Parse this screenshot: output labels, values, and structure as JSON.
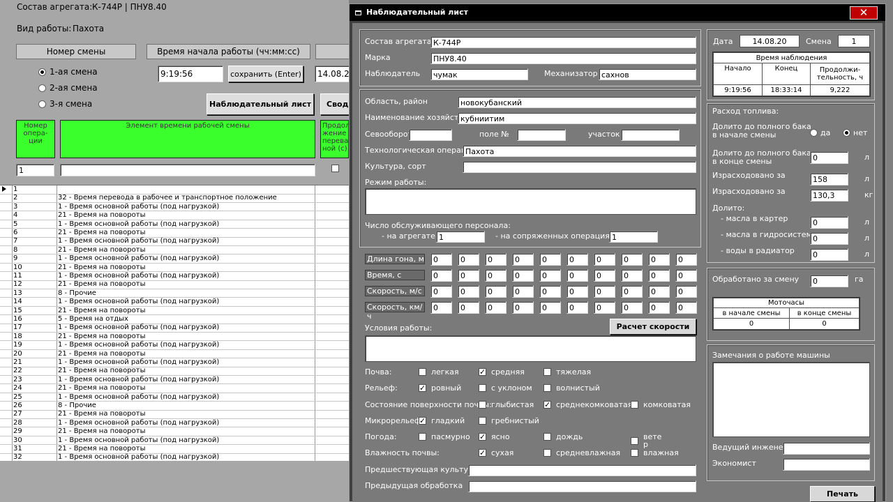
{
  "main": {
    "aggregate_label": "Состав агрегата:",
    "aggregate_value": "К-744Р | ПНУ8.40",
    "work_label": "Вид работы:",
    "work_value": "Пахота",
    "shift_header": "Номер смены",
    "start_time_header": "Время начала работы (чч:мм:сс)",
    "shifts": [
      "1-ая смена",
      "2-ая смена",
      "3-я  смена"
    ],
    "start_time_value": "9:19:56",
    "save_label": "сохранить (Enter)",
    "date_partial": "14.08.20",
    "obs_sheet_label": "Наблюдательный лист",
    "svod_label": "Свод",
    "col_op": "Номер опера-ции",
    "col_element": "Элемент времени рабочей смены",
    "col_dur": "Продол-жение перева-ной (с)",
    "op_input": "1",
    "rows": [
      {
        "n": "1",
        "t": ""
      },
      {
        "n": "2",
        "t": "32 - Время перевода в рабочее и транспортное положение"
      },
      {
        "n": "3",
        "t": "1 - Время основной работы (под нагрузкой)"
      },
      {
        "n": "4",
        "t": "21 - Время на повороты"
      },
      {
        "n": "5",
        "t": "1 - Время основной работы (под нагрузкой)"
      },
      {
        "n": "6",
        "t": "21 - Время на повороты"
      },
      {
        "n": "7",
        "t": "1 - Время основной работы (под нагрузкой)"
      },
      {
        "n": "8",
        "t": "21 - Время на повороты"
      },
      {
        "n": "9",
        "t": "1 - Время основной работы (под нагрузкой)"
      },
      {
        "n": "10",
        "t": "21 - Время на повороты"
      },
      {
        "n": "11",
        "t": "1 - Время основной работы (под нагрузкой)"
      },
      {
        "n": "12",
        "t": "21 - Время на повороты"
      },
      {
        "n": "13",
        "t": "8 - Прочие"
      },
      {
        "n": "14",
        "t": "1 - Время основной работы (под нагрузкой)"
      },
      {
        "n": "15",
        "t": "21 - Время на повороты"
      },
      {
        "n": "16",
        "t": "5 - Время на отдых"
      },
      {
        "n": "17",
        "t": "1 - Время основной работы (под нагрузкой)"
      },
      {
        "n": "18",
        "t": "21 - Время на повороты"
      },
      {
        "n": "19",
        "t": "1 - Время основной работы (под нагрузкой)"
      },
      {
        "n": "20",
        "t": "21 - Время на повороты"
      },
      {
        "n": "21",
        "t": "1 - Время основной работы (под нагрузкой)"
      },
      {
        "n": "22",
        "t": "21 - Время на повороты"
      },
      {
        "n": "23",
        "t": "1 - Время основной работы (под нагрузкой)"
      },
      {
        "n": "24",
        "t": "21 - Время на повороты"
      },
      {
        "n": "25",
        "t": "1 - Время основной работы (под нагрузкой)"
      },
      {
        "n": "26",
        "t": "8 - Прочие"
      },
      {
        "n": "27",
        "t": "21 - Время на повороты"
      },
      {
        "n": "28",
        "t": "1 - Время основной работы (под нагрузкой)"
      },
      {
        "n": "29",
        "t": "21 - Время на повороты"
      },
      {
        "n": "30",
        "t": "1 - Время основной работы (под нагрузкой)"
      },
      {
        "n": "31",
        "t": "21 - Время на повороты"
      },
      {
        "n": "32",
        "t": "1 - Время основной работы (под нагрузкой)"
      }
    ]
  },
  "dialog": {
    "title": "Наблюдательный лист",
    "aggregate_label": "Состав агрегата:",
    "aggregate_value": "К-744Р",
    "mark_label": "Марка",
    "mark_value": "ПНУ8.40",
    "observer_label": "Наблюдатель",
    "observer_value": "чумак",
    "mechanic_label": "Механизатор",
    "mechanic_value": "сахнов",
    "region_label": "Область, район",
    "region_value": "новокубанский",
    "farm_label": "Наименование хозяйства",
    "farm_value": "кубниитим",
    "crop_rotation_label": "Севооборот",
    "field_label": "поле №",
    "plot_label": "участок",
    "tech_op_label": "Технологическая операция",
    "tech_op_value": "Пахота",
    "culture_label": "Культура, сорт",
    "mode_label": "Режим работы:",
    "staff_label": "Число обслуживающего персонала:",
    "on_aggregate_label": "- на агрегате",
    "on_aggregate_value": "1",
    "on_conj_label": "- на сопряженных операциях",
    "on_conj_value": "1",
    "len_label": "Длина  гона, м",
    "time_label": "Время, с",
    "speed_ms_label": "Скорость, м/с",
    "speed_kmh_label": "Скорость, км/ч",
    "zero": "0",
    "conditions_label": "Условия работы:",
    "calc_speed_label": "Расчет скорости",
    "soil_label": "Почва:",
    "soil_opts": [
      "легкая",
      "средняя",
      "тяжелая"
    ],
    "relief_label": "Рельеф:",
    "relief_opts": [
      "ровный",
      "с уклоном",
      "волнистый"
    ],
    "surface_label": "Состояние поверхности почвы:",
    "surface_opts": [
      "глыбистая",
      "среднекомковатая",
      "комковатая"
    ],
    "micro_label": "Микрорельеф:",
    "micro_opts": [
      "гладкий",
      "гребнистый"
    ],
    "weather_label": "Погода:",
    "weather_opts": [
      "пасмурно",
      "ясно",
      "дождь",
      "вете\nр"
    ],
    "humidity_label": "Влажность почвы:",
    "humidity_opts": [
      "сухая",
      "средневлажная",
      "влажная"
    ],
    "prev_culture_label": "Предшествующая культура",
    "prev_treatment_label": "Предыдущая обработка",
    "date_label": "Дата",
    "date_value": "14.08.20",
    "shift_label": "Смена",
    "shift_value": "1",
    "obs_time_header": "Время наблюдения",
    "start_header": "Начало",
    "end_header": "Конец",
    "duration_header": "Продолжи-тельность, ч",
    "start_value": "9:19:56",
    "end_value": "18:33:14",
    "duration_value": "9,222",
    "fuel_label": "Расход топлива:",
    "topup_start_label": "Долито до полного бака в начале смены",
    "yes_label": "да",
    "no_label": "нет",
    "topup_end_label": "Долито до полного бака в конце смены",
    "topup_end_value": "0",
    "unit_l": "л",
    "unit_kg": "кг",
    "spent_label": "Израсходовано за",
    "spent_l_value": "158",
    "spent_kg_value": "130,3",
    "added_label": "Долито:",
    "oil_carter_label": "- масла в картер",
    "oil_hydro_label": "- масла в гидросистему",
    "water_label": "- воды в радиатор",
    "processed_label": "Обработано за смену",
    "processed_value": "0",
    "unit_ha": "га",
    "motohours_label": "Моточасы",
    "mh_start_label": "в начале смены",
    "mh_end_label": "в конце смены",
    "mh_start_value": "0",
    "mh_end_value": "0",
    "remarks_label": "Замечания о работе машины",
    "engineer_label": "Ведущий инженер",
    "economist_label": "Экономист",
    "print_label": "Печать"
  }
}
